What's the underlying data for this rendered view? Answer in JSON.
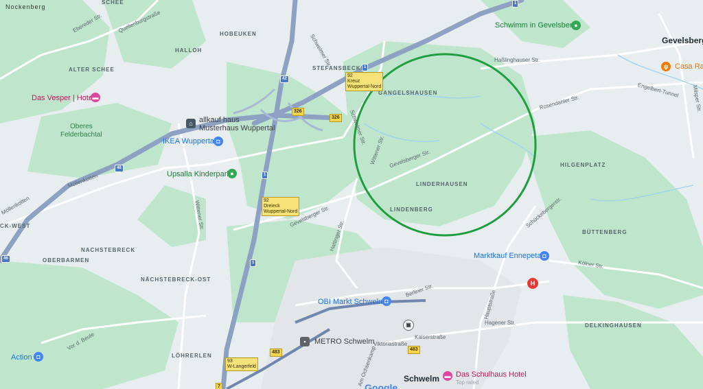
{
  "areas": {
    "nockenberg": "Nockenberg",
    "schee": "SCHEE",
    "hobeuken": "HOBEUKEN",
    "halloh": "HALLOH",
    "alter_schee": "ALTER SCHEE",
    "oberes": "Oberes",
    "felderbachtal": "Felderbachtal",
    "stefansbecke": "STEFANSBECKE",
    "gangelshausen": "GANGELSHAUSEN",
    "linderhausen": "LINDERHAUSEN",
    "lindenberg": "LINDENBERG",
    "hilgenplatz": "HILGENPLATZ",
    "buettenberg": "BÜTTENBERG",
    "nachstebreck": "NACHSTEBRECK",
    "oberbarmen": "OBERBARMEN",
    "nachstebreck_ost": "NÄCHSTEBRECK-OST",
    "loehrerlen": "LÖHRERLEN",
    "delkinghausen": "DELKINGHAUSEN",
    "ck_west": "CK-WEST",
    "gevelsberg": "Gevelsberg",
    "schwelm": "Schwelm"
  },
  "streets": {
    "ebereder": "Ebereder Str.",
    "quellenburg": "Quellenburgstraße",
    "schwelmer1": "Schwelmer Str.",
    "schwelmer2": "Schwelmer Str.",
    "hasslinghauser": "Haßlinghauser Str.",
    "engelbert": "Engelbert-Tunnel",
    "rosendahler": "Rosendahler Str.",
    "wittener_a": "Wittener Str.",
    "gevelsberger_a": "Gevelsberger Str.",
    "gevelsberger_b": "Gevelsberger Str.",
    "hattinger": "Hattinger Str.",
    "wittener_b": "Wittener Str.",
    "moellenkotten": "Möllenkotten",
    "schueckenberger": "Schückebergerstr.",
    "koelner": "Kölner Str.",
    "bergner": "Berliner Str.",
    "hauptstrasse": "Hauptstraße",
    "hagener": "Hagener Str.",
    "kaiserstrasse": "Kaiserstraße",
    "viktoriastrasse": "Viktoriastraße",
    "am_ochsenkamp": "Am Ochsenkamp",
    "milspe": "Milsper Str.",
    "vord_beule": "Vor d. Beule",
    "mollenkotten2": "Möllenkotten"
  },
  "pois": {
    "das_vesper": "Das Vesper | Hotel",
    "moebel": "allkauf haus",
    "musterhaus": "Musterhaus Wuppertal",
    "ikea": "IKEA Wuppertal",
    "upsalla": "Upsalla Kinderpark",
    "schwimm": "Schwimm in Gevelsberg",
    "casa": "Casa Ras",
    "marktkauf": "Marktkauf Ennepetal",
    "obi": "OBI Markt Schwelm",
    "metro": "METRO Schwelm",
    "schulhaus": "Das Schulhaus Hotel",
    "schulhaus_sub": "Top rated",
    "action": "Action"
  },
  "shields": {
    "b326a": "326",
    "b326b": "326",
    "b483a": "483",
    "b483b": "483",
    "a1a": "1",
    "a1b": "1",
    "a1c": "1",
    "a1d": "1",
    "a42": "42",
    "a46a": "46",
    "a46b": "46",
    "j92a": "92",
    "j92b": "92",
    "j93": "93",
    "j7": "7"
  },
  "junctions": {
    "kreuz": "Kreuz",
    "kreuz_name": "Wuppertal-Nord",
    "dreieck": "Dreieck",
    "dreieck_name": "Wuppertal-Nord",
    "langerfeld": "W-Langerfeld"
  },
  "brand": {
    "google": "Google"
  },
  "icons": {
    "hotel": "bed-icon",
    "store": "shopping-bag-icon",
    "park": "park-icon",
    "food": "restaurant-icon",
    "hospital": "hospital-icon",
    "train": "train-icon",
    "home": "home-store-icon"
  },
  "colors": {
    "land": "#e8eef0",
    "forest": "#b6e3c5",
    "motorway": "#8da2c2",
    "road": "#ffffff",
    "circle": "#1e9e3e",
    "hospital": "#e53935"
  }
}
